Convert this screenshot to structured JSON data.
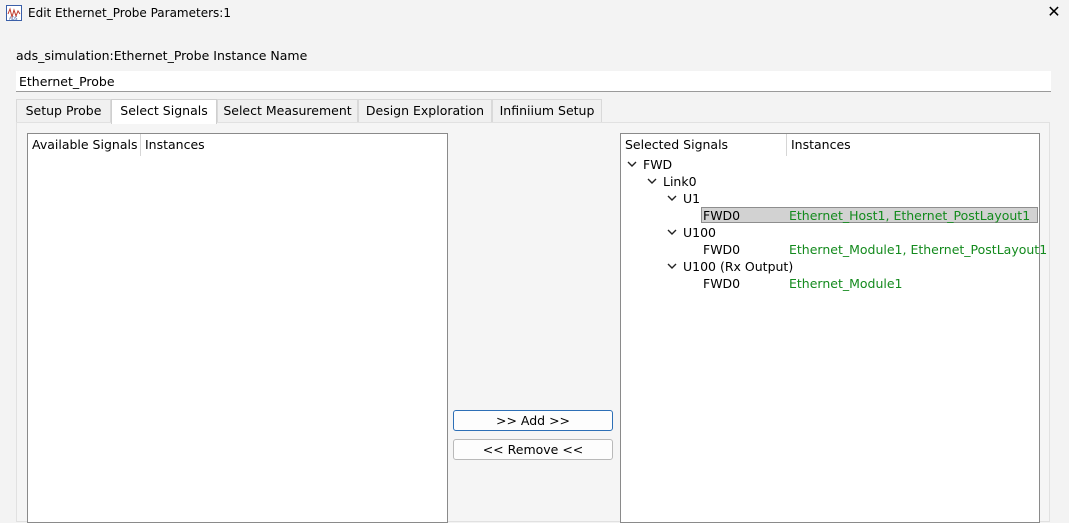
{
  "window": {
    "title": "Edit Ethernet_Probe Parameters:1",
    "close_glyph": "✕"
  },
  "instance": {
    "label": "ads_simulation:Ethernet_Probe Instance Name",
    "value": "Ethernet_Probe"
  },
  "tabs": [
    {
      "label": "Setup Probe",
      "active": false
    },
    {
      "label": "Select Signals",
      "active": true
    },
    {
      "label": "Select Measurement",
      "active": false
    },
    {
      "label": "Design Exploration",
      "active": false
    },
    {
      "label": "Infiniium Setup",
      "active": false
    }
  ],
  "available": {
    "col_signals": "Available Signals",
    "col_instances": "Instances"
  },
  "selected": {
    "col_signals": "Selected Signals",
    "col_instances": "Instances",
    "rows": [
      {
        "label": "FWD",
        "instances": "",
        "expanded": true
      },
      {
        "label": "Link0",
        "instances": "",
        "expanded": true
      },
      {
        "label": "U1",
        "instances": "",
        "expanded": true
      },
      {
        "label": "FWD0",
        "instances": "Ethernet_Host1, Ethernet_PostLayout1",
        "selected": true
      },
      {
        "label": "U100",
        "instances": "",
        "expanded": true
      },
      {
        "label": "FWD0",
        "instances": "Ethernet_Module1, Ethernet_PostLayout1"
      },
      {
        "label": "U100 (Rx Output)",
        "instances": "",
        "expanded": true
      },
      {
        "label": "FWD0",
        "instances": "Ethernet_Module1"
      }
    ]
  },
  "buttons": {
    "add": ">> Add >>",
    "remove": "<< Remove <<"
  },
  "colors": {
    "instance_text": "#138a1d",
    "selection_bg": "#d2d2d2",
    "primary_border": "#2d6fb6"
  }
}
